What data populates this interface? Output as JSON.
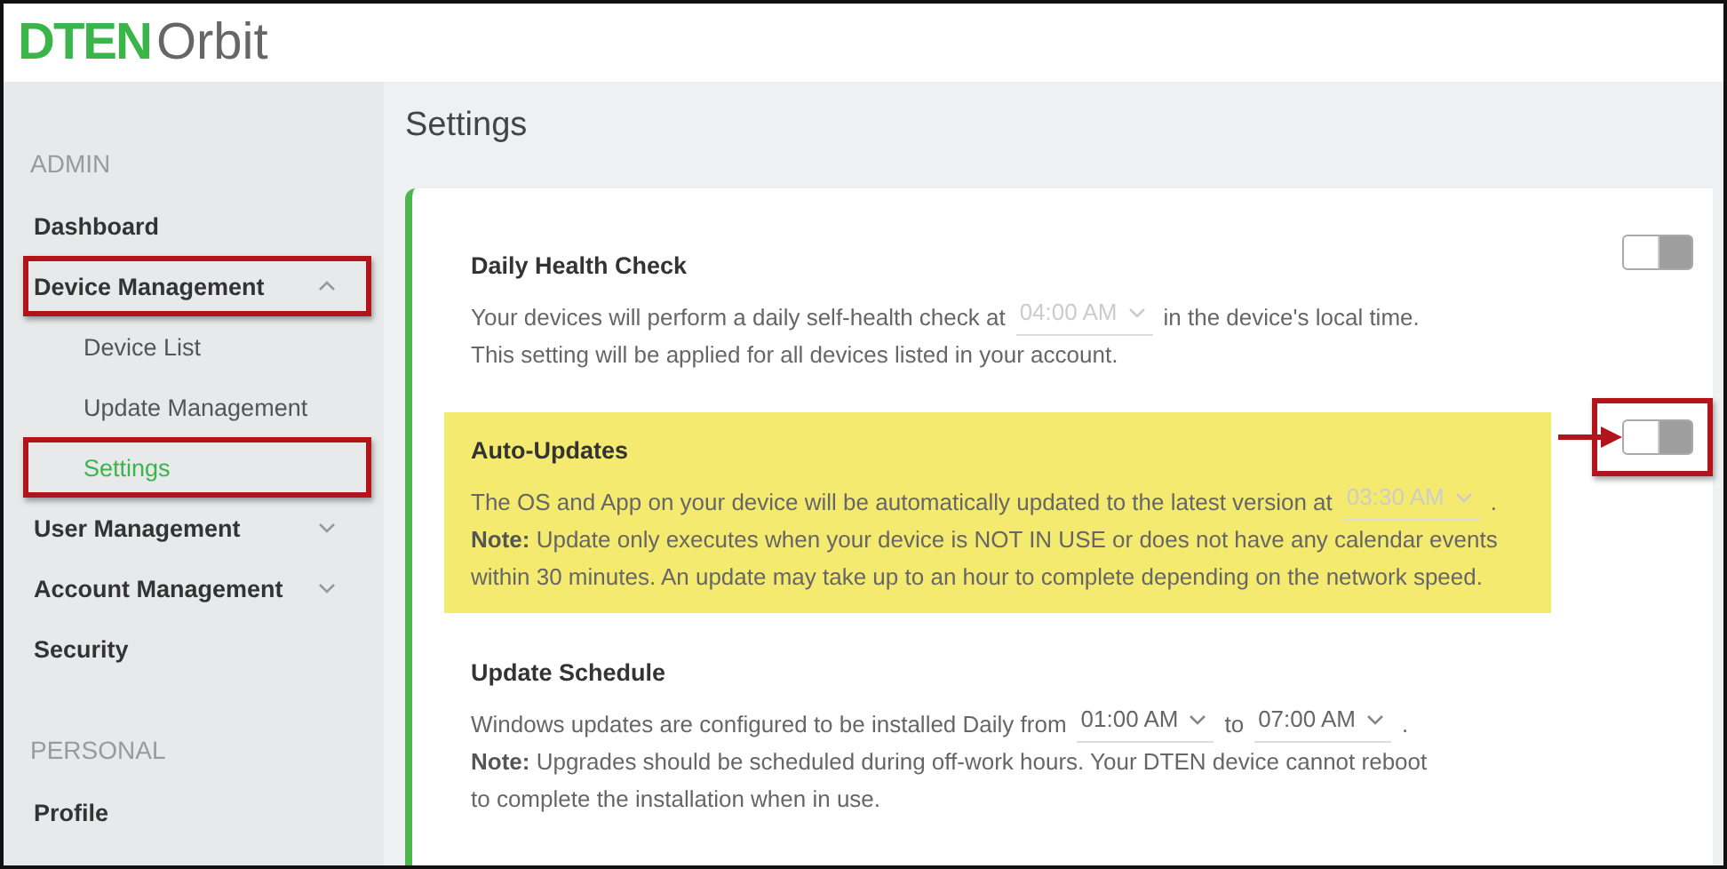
{
  "logo": {
    "brand": "DTEN",
    "product": "Orbit"
  },
  "sidebar": {
    "sections": [
      {
        "heading": "ADMIN",
        "items": [
          {
            "label": "Dashboard",
            "selected": false,
            "annotated": false
          },
          {
            "label": "Device Management",
            "selected": false,
            "annotated": true,
            "expanded": true,
            "children": [
              {
                "label": "Device List",
                "selected": false,
                "annotated": false
              },
              {
                "label": "Update Management",
                "selected": false,
                "annotated": false
              },
              {
                "label": "Settings",
                "selected": true,
                "annotated": true
              }
            ]
          },
          {
            "label": "User Management",
            "selected": false,
            "annotated": false,
            "expanded": false
          },
          {
            "label": "Account Management",
            "selected": false,
            "annotated": false,
            "expanded": false
          },
          {
            "label": "Security",
            "selected": false,
            "annotated": false
          }
        ]
      },
      {
        "heading": "PERSONAL",
        "items": [
          {
            "label": "Profile",
            "selected": false,
            "annotated": false
          }
        ]
      }
    ]
  },
  "page_title": "Settings",
  "settings": [
    {
      "title": "Daily Health Check",
      "highlighted": false,
      "toggle": {
        "on": false,
        "annotated": false
      },
      "lines": [
        [
          {
            "kind": "text",
            "text": "Your devices will perform a daily self-health check at"
          },
          {
            "kind": "select",
            "value": "04:00 AM",
            "disabled": true
          },
          {
            "kind": "text",
            "text": "in the device's local time."
          }
        ],
        [
          {
            "kind": "text",
            "text": "This setting will be applied for all devices listed in  your account."
          }
        ]
      ]
    },
    {
      "title": "Auto-Updates",
      "highlighted": true,
      "toggle": {
        "on": false,
        "annotated": true
      },
      "lines": [
        [
          {
            "kind": "text",
            "text": "The OS and App on your device will be automatically updated to the latest version at"
          },
          {
            "kind": "select",
            "value": "03:30 AM",
            "disabled": true
          },
          {
            "kind": "text",
            "text": "."
          }
        ],
        [
          {
            "kind": "text",
            "text": "**Note:** Update only executes when your device is NOT IN USE or does not have any calendar events"
          }
        ],
        [
          {
            "kind": "text",
            "text": "within 30 minutes.   An update may take up  to an hour to complete depending on the network speed."
          }
        ]
      ]
    },
    {
      "title": "Update Schedule",
      "highlighted": false,
      "lines": [
        [
          {
            "kind": "text",
            "text": "Windows updates are configured to be installed Daily from"
          },
          {
            "kind": "select",
            "value": "01:00 AM",
            "disabled": false
          },
          {
            "kind": "text",
            "text": "to"
          },
          {
            "kind": "select",
            "value": "07:00 AM",
            "disabled": false
          },
          {
            "kind": "text",
            "text": "."
          }
        ],
        [
          {
            "kind": "text",
            "text": "**Note:** Upgrades should be scheduled during off-work hours. Your DTEN device cannot reboot"
          }
        ],
        [
          {
            "kind": "text",
            "text": "to complete the installation when in use."
          }
        ]
      ]
    }
  ]
}
